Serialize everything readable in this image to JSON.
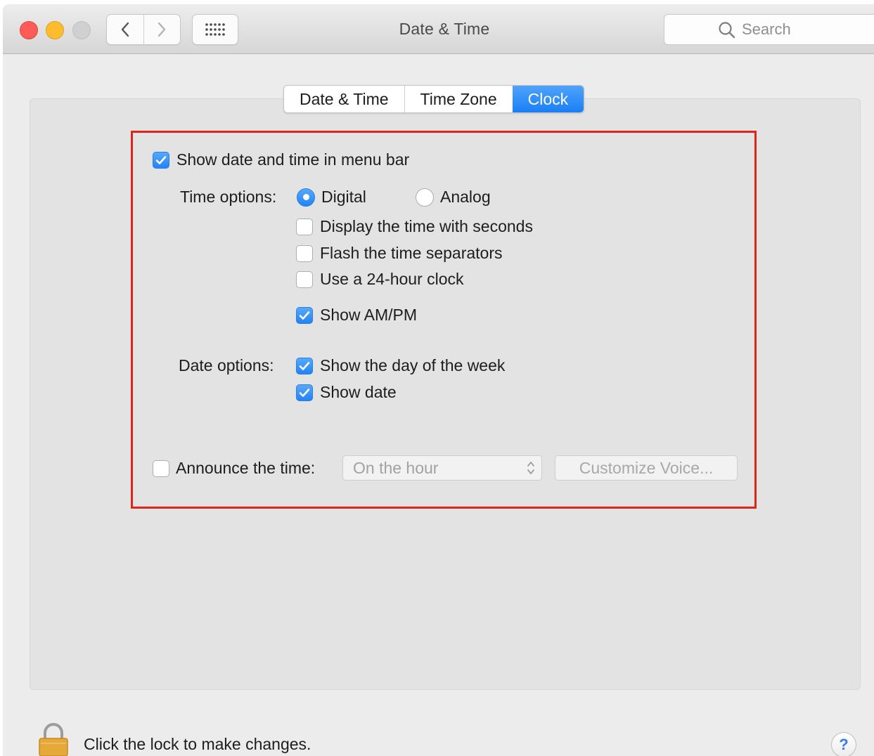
{
  "window": {
    "title": "Date & Time",
    "search": {
      "placeholder": "Search"
    }
  },
  "tabs": [
    {
      "label": "Date & Time",
      "active": false
    },
    {
      "label": "Time Zone",
      "active": false
    },
    {
      "label": "Clock",
      "active": true
    }
  ],
  "clock": {
    "show_in_menu_bar": {
      "label": "Show date and time in menu bar",
      "checked": true
    },
    "time_options": {
      "label": "Time options:",
      "digital": {
        "label": "Digital",
        "selected": true
      },
      "analog": {
        "label": "Analog",
        "selected": false
      },
      "seconds": {
        "label": "Display the time with seconds",
        "checked": false
      },
      "flash_separators": {
        "label": "Flash the time separators",
        "checked": false
      },
      "use_24_hour": {
        "label": "Use a 24-hour clock",
        "checked": false
      },
      "show_ampm": {
        "label": "Show AM/PM",
        "checked": true
      }
    },
    "date_options": {
      "label": "Date options:",
      "day_of_week": {
        "label": "Show the day of the week",
        "checked": true
      },
      "show_date": {
        "label": "Show date",
        "checked": true
      }
    },
    "announce": {
      "label": "Announce the time:",
      "checked": false,
      "interval": "On the hour",
      "customize_voice_label": "Customize Voice..."
    }
  },
  "footer": {
    "lock_text": "Click the lock to make changes.",
    "help_label": "?"
  },
  "colors": {
    "accent": "#2384f6",
    "highlight_border": "#e0241b",
    "close": "#fc5b57",
    "minimize": "#fdbc2e",
    "lock": "#e5a93a"
  },
  "icons": {
    "back": "chevron-left-icon",
    "forward": "chevron-right-icon",
    "show_all": "grid-icon",
    "search": "search-icon",
    "lock": "lock-icon",
    "checkmark": "checkmark-icon",
    "popup": "up-down-arrows-icon"
  }
}
